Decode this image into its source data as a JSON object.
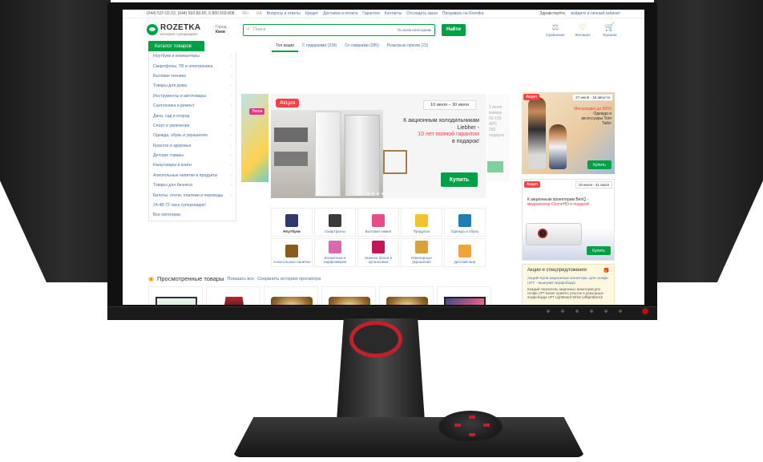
{
  "topbar": {
    "phones": "(044) 537-02-22, (044) 503-80-80, 0 800 503-808",
    "lang_ru": "RU",
    "lang_ua": "UA",
    "links": [
      "Вопросы и ответы",
      "Кредит",
      "Доставка и оплата",
      "Гарантия",
      "Контакты",
      "Отследить заказ",
      "Продавать на Rozetka"
    ],
    "greeting": "Здравствуйте,",
    "login": "войдите в личный кабинет"
  },
  "header": {
    "logo_name": "ROZETKA",
    "logo_sub": "интернет-супермаркет",
    "city_label": "Город",
    "city": "Киев",
    "search_placeholder": "Поиск",
    "search_category": "По всем категориям",
    "search_button": "Найти",
    "compare": "Сравнение",
    "wishlist": "Желания",
    "cart": "Корзина"
  },
  "catalog": {
    "button": "Каталог товаров",
    "items": [
      "Ноутбуки и компьютеры",
      "Смартфоны, ТВ и электроника",
      "Бытовая техника",
      "Товары для дома",
      "Инструменты и автотовары",
      "Сантехника и ремонт",
      "Дача, сад и огород",
      "Спорт и увлечения",
      "Одежда, обувь и украшения",
      "Красота и здоровье",
      "Детские товары",
      "Канцтовары и книги",
      "Алкогольные напитки и продукты",
      "Товары для бизнеса",
      "Билеты, отели, платежи и переводы",
      "24-48-72 часа суперскидок!",
      "Все категории"
    ]
  },
  "promo_tabs": [
    "Топ акции",
    "С подарками (218)",
    "Со скидками (285)",
    "Розыгрыш призов (21)"
  ],
  "slider": {
    "side_badge": "Экска",
    "badge": "Акция",
    "dates": "10 июля – 30 июля",
    "headline_1": "К акционным холодильникам Liebher -",
    "headline_red": "10 лет полной гарантии",
    "headline_2": "в подарок!",
    "buy": "Купить",
    "side_text": "1 июля\nкамеру\n03-100\nAPC\n350\nподарок"
  },
  "tiles": [
    {
      "label": "Ноутбуки",
      "color": "#2f3a6b"
    },
    {
      "label": "Смартфоны",
      "color": "#3a3a3a"
    },
    {
      "label": "Бытовая химия",
      "color": "#e84a8a"
    },
    {
      "label": "Продукты",
      "color": "#f2c230"
    },
    {
      "label": "Одежда и обувь",
      "color": "#1f7fb5"
    },
    {
      "label": "Алкогольные напитки",
      "color": "#8a5a1f"
    },
    {
      "label": "Косметика и парфюмерия",
      "color": "#d86ab0"
    },
    {
      "label": "Нижнее белье и купальники",
      "color": "#c2185b"
    },
    {
      "label": "Ювелирные украшения",
      "color": "#d6a23a"
    },
    {
      "label": "Детский мир",
      "color": "#f2a33a"
    }
  ],
  "banners": {
    "b1_badge": "Акция",
    "b1_date": "27 июля - 16 августа",
    "b1_red": "Мегаскидки до 50%!",
    "b1_text": "Одежда и аксессуары Tom Tailor",
    "b1_buy": "Купить",
    "b2_badge": "Акция",
    "b2_date": "19 июля - 31 июля",
    "b2_text": "К акционным проекторам BenQ -",
    "b2_red": "медиаплеер OzoneHD в подарок!",
    "b2_buy": "Купить"
  },
  "aside": {
    "title": "Акции и спецпредложения",
    "link": "Акция! Купи акционные мониторы для селфи UFT - выиграй перфоборд!",
    "desc": "Каждый покупатель акционных мониторов для селфи UFT может принять участие в розыгрыше перфоборда UFT LightBoard White (uftlightblack)!"
  },
  "viewed": {
    "title": "Просмотренные товары",
    "show_all": "Показать все",
    "save_history": "Сохранить историю просмотра"
  }
}
